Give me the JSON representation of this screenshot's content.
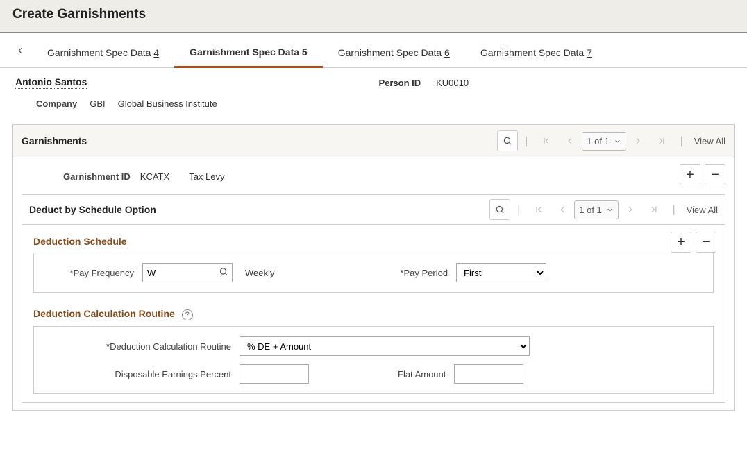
{
  "page": {
    "title": "Create Garnishments"
  },
  "tabs": [
    {
      "prefix": "Garnishment Spec Data ",
      "num": "4"
    },
    {
      "prefix": "Garnishment Spec Data ",
      "num": "5"
    },
    {
      "prefix": "Garnishment Spec Data ",
      "num": "6"
    },
    {
      "prefix": "Garnishment Spec Data ",
      "num": "7"
    }
  ],
  "person": {
    "name": "Antonio Santos",
    "id_label": "Person ID",
    "id_value": "KU0010",
    "company_label": "Company",
    "company_code": "GBI",
    "company_name": "Global Business Institute"
  },
  "garnishments": {
    "title": "Garnishments",
    "range": "1 of 1",
    "view_all": "View All",
    "id_label": "Garnishment ID",
    "id_value": "KCATX",
    "id_desc": "Tax Levy"
  },
  "schedule_panel": {
    "title": "Deduct by Schedule Option",
    "range": "1 of 1",
    "view_all": "View All"
  },
  "schedule_section": {
    "title": "Deduction Schedule",
    "pay_frequency_label": "Pay Frequency",
    "pay_frequency_value": "W",
    "pay_frequency_desc": "Weekly",
    "pay_period_label": "Pay Period",
    "pay_period_value": "First"
  },
  "routine_section": {
    "title": "Deduction Calculation Routine",
    "routine_label": "Deduction Calculation Routine",
    "routine_value": "% DE + Amount",
    "de_percent_label": "Disposable Earnings Percent",
    "flat_amount_label": "Flat Amount"
  }
}
